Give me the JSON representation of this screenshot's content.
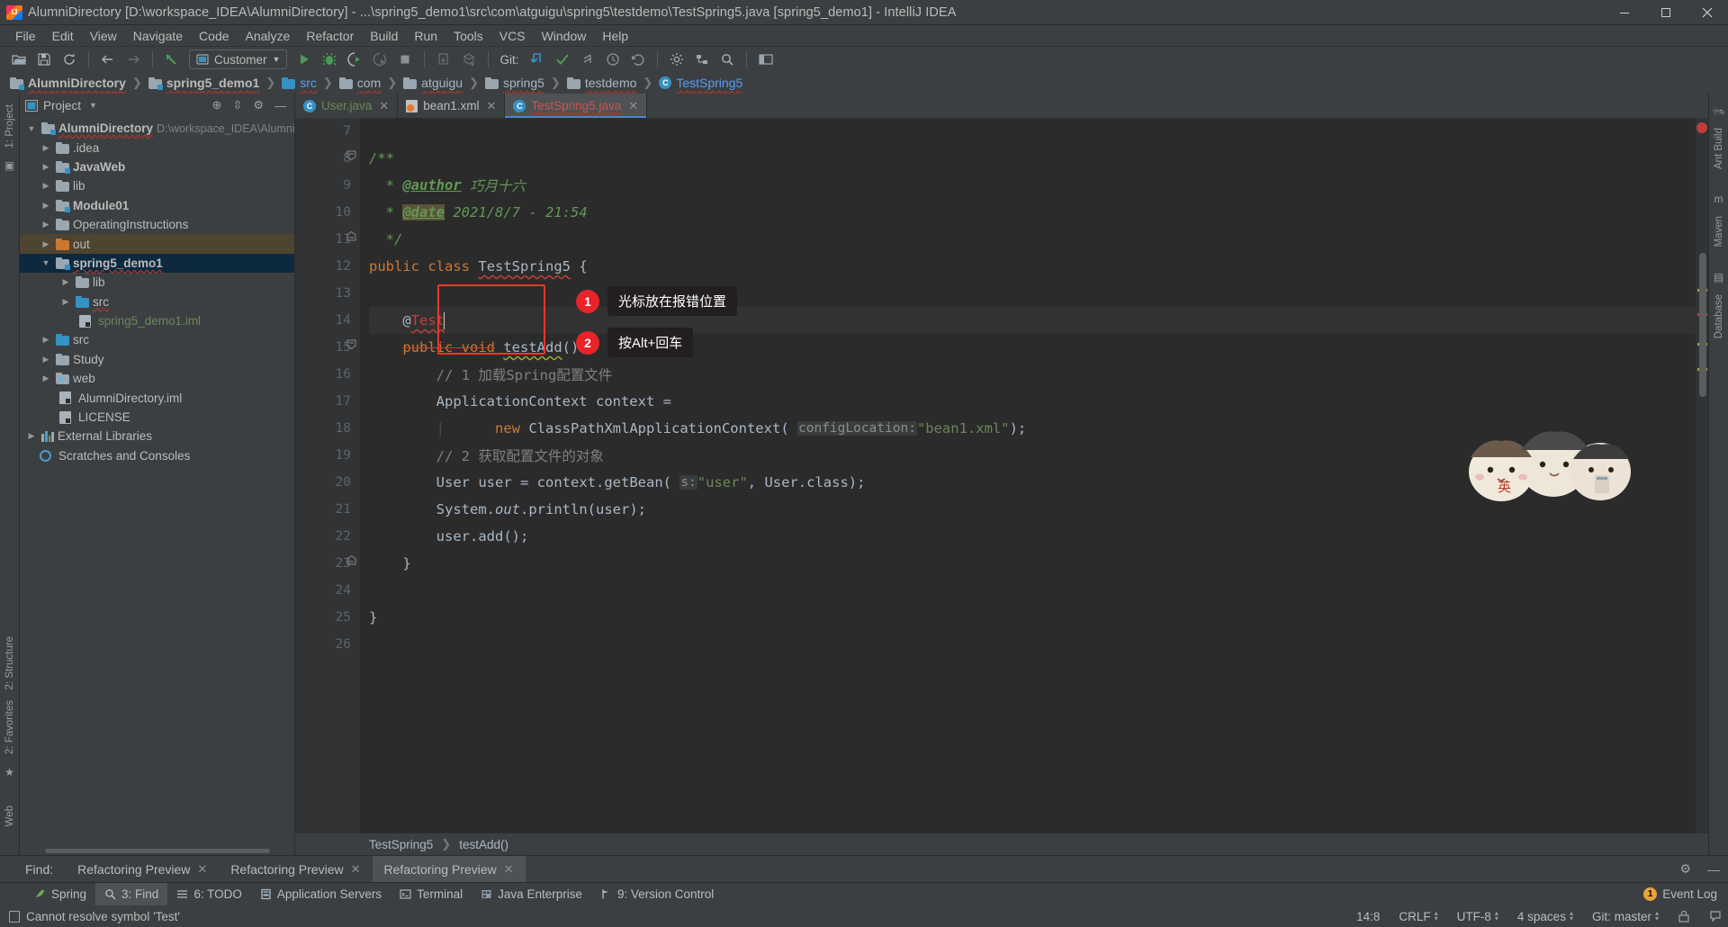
{
  "window": {
    "title": "AlumniDirectory [D:\\workspace_IDEA\\AlumniDirectory] - ...\\spring5_demo1\\src\\com\\atguigu\\spring5\\testdemo\\TestSpring5.java [spring5_demo1] - IntelliJ IDEA",
    "app_icon": "intellij-idea-icon",
    "minimize": "minimize-icon",
    "maximize": "maximize-icon",
    "close": "close-icon"
  },
  "menubar": {
    "items": [
      {
        "label": "File"
      },
      {
        "label": "Edit"
      },
      {
        "label": "View"
      },
      {
        "label": "Navigate"
      },
      {
        "label": "Code"
      },
      {
        "label": "Analyze"
      },
      {
        "label": "Refactor"
      },
      {
        "label": "Build"
      },
      {
        "label": "Run"
      },
      {
        "label": "Tools"
      },
      {
        "label": "VCS"
      },
      {
        "label": "Window"
      },
      {
        "label": "Help"
      }
    ]
  },
  "toolbar": {
    "open_icon": "open-folder-icon",
    "save_icon": "save-icon",
    "sync_icon": "sync-icon",
    "back_icon": "back-arrow-icon",
    "forward_icon": "forward-arrow-icon",
    "revert_icon": "revert-icon",
    "run_config_label": "Customer",
    "run_config_icon": "run-configuration-icon",
    "run_config_chevron": "chevron-down-icon",
    "run_icon": "run-icon",
    "debug_icon": "debug-icon",
    "run_coverage_icon": "run-with-coverage-icon",
    "profile_icon": "profile-icon",
    "stop_icon": "stop-icon",
    "build_icon": "build-module-icon",
    "build_artifacts_icon": "build-artifacts-icon",
    "git_label": "Git:",
    "update_icon": "update-project-icon",
    "commit_icon": "commit-icon",
    "push_icon": "push-icon",
    "history_icon": "history-icon",
    "rollback_icon": "rollback-icon",
    "settings_icon": "settings-icon",
    "structure_icon": "project-structure-icon",
    "search_icon": "search-everywhere-icon",
    "layout_icon": "layout-icon"
  },
  "breadcrumb": {
    "items": [
      {
        "label": "AlumniDirectory",
        "icon": "module-folder-icon",
        "style": "bold"
      },
      {
        "label": "spring5_demo1",
        "icon": "module-folder-icon",
        "style": "bold"
      },
      {
        "label": "src",
        "icon": "source-folder-icon",
        "style": "normal"
      },
      {
        "label": "com",
        "icon": "package-folder-icon",
        "style": "normal"
      },
      {
        "label": "atguigu",
        "icon": "package-folder-icon",
        "style": "normal"
      },
      {
        "label": "spring5",
        "icon": "package-folder-icon",
        "style": "normal"
      },
      {
        "label": "testdemo",
        "icon": "package-folder-icon",
        "style": "normal"
      },
      {
        "label": "TestSpring5",
        "icon": "class-icon",
        "style": "class"
      }
    ]
  },
  "project_panel": {
    "title": "Project",
    "title_chevron": "chevron-down-icon",
    "locate_icon": "locate-file-icon",
    "collapse_icon": "collapse-all-icon",
    "hide_icon": "hide-panel-icon",
    "settings_icon": "gear-icon",
    "tree": [
      {
        "label": "AlumniDirectory",
        "path": "D:\\workspace_IDEA\\Alumni",
        "indent": 0,
        "arrow": "down",
        "icon": "module-folder",
        "bold": true,
        "squiggle": true
      },
      {
        "label": ".idea",
        "indent": 1,
        "arrow": "right",
        "icon": "gray-folder"
      },
      {
        "label": "JavaWeb",
        "indent": 1,
        "arrow": "right",
        "icon": "module-folder",
        "bold": true
      },
      {
        "label": "lib",
        "indent": 1,
        "arrow": "right",
        "icon": "gray-folder"
      },
      {
        "label": "Module01",
        "indent": 1,
        "arrow": "right",
        "icon": "module-folder",
        "bold": true
      },
      {
        "label": "OperatingInstructions",
        "indent": 1,
        "arrow": "right",
        "icon": "gray-folder"
      },
      {
        "label": "out",
        "indent": 1,
        "arrow": "right",
        "icon": "orange-folder",
        "row_state": "hover"
      },
      {
        "label": "spring5_demo1",
        "indent": 1,
        "arrow": "down",
        "icon": "module-folder",
        "bold": true,
        "squiggle": true,
        "row_state": "selected"
      },
      {
        "label": "lib",
        "indent": 2,
        "arrow": "right",
        "icon": "gray-folder"
      },
      {
        "label": "src",
        "indent": 2,
        "arrow": "right",
        "icon": "source-folder",
        "squiggle": true
      },
      {
        "label": "spring5_demo1.iml",
        "indent": 2,
        "arrow": "none",
        "icon": "iml-file",
        "green": true
      },
      {
        "label": "src",
        "indent": 1,
        "arrow": "right",
        "icon": "source-folder"
      },
      {
        "label": "Study",
        "indent": 1,
        "arrow": "right",
        "icon": "gray-folder"
      },
      {
        "label": "web",
        "indent": 1,
        "arrow": "right",
        "icon": "web-folder"
      },
      {
        "label": "AlumniDirectory.iml",
        "indent": 1,
        "arrow": "none",
        "icon": "iml-file"
      },
      {
        "label": "LICENSE",
        "indent": 1,
        "arrow": "none",
        "icon": "text-file"
      },
      {
        "label": "External Libraries",
        "indent": 0,
        "arrow": "right",
        "icon": "libraries"
      },
      {
        "label": "Scratches and Consoles",
        "indent": 0,
        "arrow": "none",
        "icon": "scratches"
      }
    ]
  },
  "left_rail": {
    "items": [
      {
        "label": "1: Project",
        "icon": "project-tool-icon"
      },
      {
        "label": "2: Structure",
        "icon": "structure-tool-icon"
      },
      {
        "label": "2: Favorites",
        "icon": "favorites-tool-icon"
      },
      {
        "label": "Web",
        "icon": "web-tool-icon"
      }
    ]
  },
  "right_rail": {
    "items": [
      {
        "label": "Ant Build",
        "icon": "ant-build-icon"
      },
      {
        "label": "Maven",
        "icon": "maven-icon"
      },
      {
        "label": "Database",
        "icon": "database-icon"
      }
    ]
  },
  "editor": {
    "tabs": [
      {
        "label": "User.java",
        "icon": "java-class-icon",
        "color": "green",
        "active": false,
        "close": "close-icon"
      },
      {
        "label": "bean1.xml",
        "icon": "spring-xml-icon",
        "color": "normal",
        "active": false,
        "close": "close-icon"
      },
      {
        "label": "TestSpring5.java",
        "icon": "java-class-icon",
        "color": "red",
        "active": true,
        "close": "close-icon"
      }
    ],
    "first_line_number": 7,
    "lines": [
      {
        "n": 7,
        "text": ""
      },
      {
        "n": 8,
        "text": "/**"
      },
      {
        "n": 9,
        "text": " * @author 巧月十六"
      },
      {
        "n": 10,
        "text": " * @date 2021/8/7 - 21:54"
      },
      {
        "n": 11,
        "text": " */"
      },
      {
        "n": 12,
        "text": "public class TestSpring5 {"
      },
      {
        "n": 13,
        "text": ""
      },
      {
        "n": 14,
        "text": "    @Test"
      },
      {
        "n": 15,
        "text": "    public void testAdd(){"
      },
      {
        "n": 16,
        "text": "        // 1 加载Spring配置文件"
      },
      {
        "n": 17,
        "text": "        ApplicationContext context ="
      },
      {
        "n": 18,
        "text": "                new ClassPathXmlApplicationContext( configLocation: \"bean1.xml\");"
      },
      {
        "n": 19,
        "text": "        // 2 获取配置文件的对象"
      },
      {
        "n": 20,
        "text": "        User user = context.getBean( s: \"user\", User.class);"
      },
      {
        "n": 21,
        "text": "        System.out.println(user);"
      },
      {
        "n": 22,
        "text": "        user.add();"
      },
      {
        "n": 23,
        "text": "    }"
      },
      {
        "n": 24,
        "text": ""
      },
      {
        "n": 25,
        "text": "}"
      },
      {
        "n": 26,
        "text": ""
      }
    ],
    "javadoc": {
      "author_tag": "@author",
      "author_value": "巧月十六",
      "date_tag": "@date",
      "date_value": "2021/8/7 - 21:54"
    },
    "code_tokens": {
      "public": "public",
      "class": "class",
      "class_name": "TestSpring5",
      "annotation_at": "@",
      "annotation_name": "Test",
      "void": "void",
      "method_name": "testAdd",
      "comment_1": "// 1 加载Spring配置文件",
      "type_app_context": "ApplicationContext",
      "var_context": "context",
      "new": "new",
      "ctor_name": "ClassPathXmlApplicationContext",
      "hint_config_location": "configLocation:",
      "str_bean_xml": "\"bean1.xml\"",
      "comment_2": "// 2 获取配置文件的对象",
      "type_user": "User",
      "var_user": "user",
      "get_bean": "getBean",
      "hint_s": "s:",
      "str_user": "\"user\"",
      "user_class": "User.class",
      "system": "System",
      "out": "out",
      "println": "println",
      "add": "add"
    },
    "breadcrumb": [
      {
        "label": "TestSpring5"
      },
      {
        "label": "testAdd()"
      }
    ]
  },
  "annotations": {
    "callouts": [
      {
        "number": "1",
        "text": "光标放在报错位置"
      },
      {
        "number": "2",
        "text": "按Alt+回车"
      }
    ],
    "highlight_box_color": "#f1352b"
  },
  "find_panel": {
    "label": "Find:",
    "tabs": [
      {
        "label": "Refactoring Preview",
        "active": false,
        "close": "close-icon"
      },
      {
        "label": "Refactoring Preview",
        "active": false,
        "close": "close-icon"
      },
      {
        "label": "Refactoring Preview",
        "active": true,
        "close": "close-icon"
      }
    ],
    "settings_icon": "gear-icon",
    "hide_icon": "minimize-icon"
  },
  "tool_windows": {
    "tabs": [
      {
        "label": "Spring",
        "mnemonic": "",
        "icon": "spring-icon",
        "active": false
      },
      {
        "label": "3: Find",
        "mnemonic": "3",
        "icon": "search-icon",
        "active": true
      },
      {
        "label": "6: TODO",
        "mnemonic": "6",
        "icon": "todo-icon",
        "active": false
      },
      {
        "label": "Application Servers",
        "mnemonic": "",
        "icon": "app-servers-icon",
        "active": false
      },
      {
        "label": "Terminal",
        "mnemonic": "",
        "icon": "terminal-icon",
        "active": false
      },
      {
        "label": "Java Enterprise",
        "mnemonic": "",
        "icon": "java-enterprise-icon",
        "active": false
      },
      {
        "label": "9: Version Control",
        "mnemonic": "9",
        "icon": "version-control-icon",
        "active": false
      }
    ],
    "event_log": {
      "label": "Event Log",
      "badge": "1",
      "icon": "event-log-icon"
    }
  },
  "statusbar": {
    "message": "Cannot resolve symbol 'Test'",
    "message_icon": "inspection-icon",
    "caret_position": "14:8",
    "line_separator": "CRLF",
    "encoding": "UTF-8",
    "indent": "4 spaces",
    "branch": "Git: master",
    "lock_icon": "read-only-icon",
    "balloon_icon": "notifications-icon"
  },
  "colors": {
    "accent": "#4a88c7",
    "selection": "#0d293e",
    "error": "#bc3f3c",
    "annotation_red": "#f1352b",
    "editor_bg": "#2b2b2b",
    "panel_bg": "#3c3f41"
  }
}
